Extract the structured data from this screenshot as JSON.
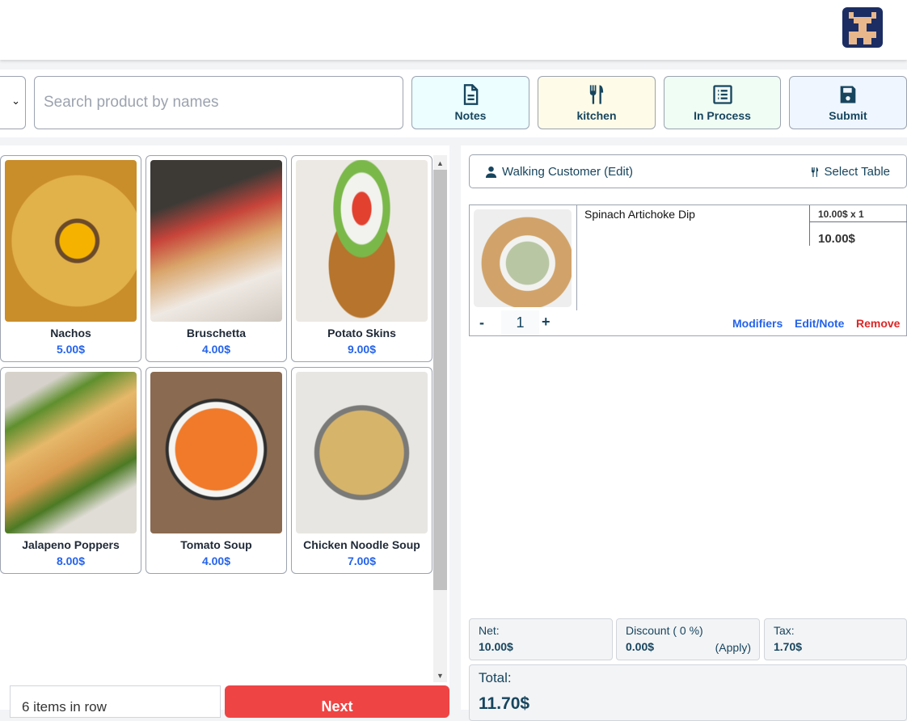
{
  "header": {
    "logo": "pixel-art avatar logo"
  },
  "toolbar": {
    "search_placeholder": "Search product by names",
    "buttons": [
      {
        "label": "Notes",
        "icon": "file-text-icon",
        "bg": "#ecfeff"
      },
      {
        "label": "kitchen",
        "icon": "utensils-icon",
        "bg": "#fefce8"
      },
      {
        "label": "In Process",
        "icon": "list-icon",
        "bg": "#f0fdf4"
      },
      {
        "label": "Submit",
        "icon": "save-icon",
        "bg": "#eff6ff"
      }
    ]
  },
  "products": [
    {
      "name": "Nachos",
      "price": "5.00$"
    },
    {
      "name": "Bruschetta",
      "price": "4.00$"
    },
    {
      "name": "Potato Skins",
      "price": "9.00$"
    },
    {
      "name": "Jalapeno Poppers",
      "price": "8.00$"
    },
    {
      "name": "Tomato Soup",
      "price": "4.00$"
    },
    {
      "name": "Chicken Noodle Soup",
      "price": "7.00$"
    }
  ],
  "footer": {
    "per_row": "6 items in row",
    "next_label": "Next"
  },
  "order": {
    "customer": "Walking Customer (Edit)",
    "table": "Select Table",
    "items": [
      {
        "name": "Spinach Artichoke Dip",
        "unit": "10.00$ x 1",
        "total": "10.00$",
        "qty": "1"
      }
    ],
    "actions": {
      "minus": "-",
      "plus": "+",
      "modifiers": "Modifiers",
      "edit": "Edit/Note",
      "remove": "Remove"
    },
    "summary": {
      "net_label": "Net:",
      "net": "10.00$",
      "discount_label": "Discount ( 0 %)",
      "discount": "0.00$",
      "apply": "(Apply)",
      "tax_label": "Tax:",
      "tax": "1.70$",
      "total_label": "Total:",
      "total": "11.70$"
    }
  },
  "colors": {
    "accent": "#17455e",
    "link": "#2563eb",
    "danger": "#dc2626",
    "next": "#ef4444"
  }
}
